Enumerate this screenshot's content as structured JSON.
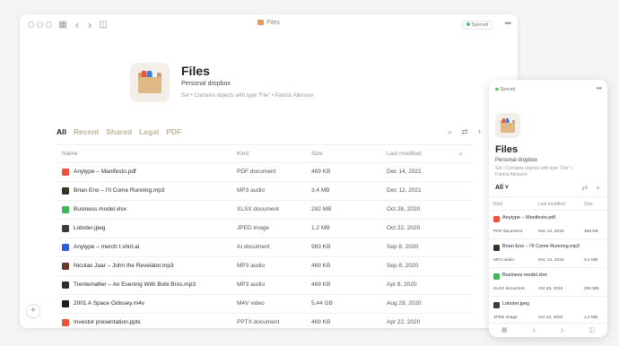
{
  "window": {
    "title": "Files",
    "sync_status": "Synced",
    "more": "•••",
    "grid_icon": "▦",
    "back_icon": "‹",
    "forward_icon": "›",
    "sidebar_icon": "◫"
  },
  "header": {
    "title": "Files",
    "subtitle": "Personal dropbox",
    "meta": "Set  •  Contains objects with type “File”  •  Patrick Atkinson"
  },
  "tabs": [
    "All",
    "Recent",
    "Shared",
    "Legal",
    "PDF"
  ],
  "toolbar": {
    "search": "⌕",
    "filter": "⇄",
    "add": "+"
  },
  "table": {
    "columns": [
      "Name",
      "Kind",
      "Size",
      "Last modified"
    ],
    "add": "+",
    "rows": [
      {
        "name": "Anytype – Manifesto.pdf",
        "kind": "PDF document",
        "size": "469 KB",
        "modified": "Dec 14, 2021",
        "color": "#e8553b"
      },
      {
        "name": "Brian Eno – I’ll Come Running.mp3",
        "kind": "MP3 audio",
        "size": "3,4 MB",
        "modified": "Dec 12, 2021",
        "color": "#3a3226"
      },
      {
        "name": "Business model.xlsx",
        "kind": "XLSX document",
        "size": "292 MB",
        "modified": "Oct 28, 2020",
        "color": "#43b55c"
      },
      {
        "name": "Lobster.jpeg",
        "kind": "JPED image",
        "size": "1,2 MB",
        "modified": "Oct 22, 2020",
        "color": "#3c3c3c"
      },
      {
        "name": "Anytype – merch t shirt.ai",
        "kind": "AI document",
        "size": "983 KB",
        "modified": "Sep 8, 2020",
        "color": "#2f5fd8"
      },
      {
        "name": "Nicolas Jaar – John the Revelator.mp3",
        "kind": "MP3 audio",
        "size": "469 KB",
        "modified": "Sep 8, 2020",
        "color": "#6a3a2c"
      },
      {
        "name": "Trentemøller – An Evening With Bobi Bros.mp3",
        "kind": "MP3 audio",
        "size": "469 KB",
        "modified": "Apr 8, 2020",
        "color": "#2e2e2e"
      },
      {
        "name": "2001 A Space Odissey.m4v",
        "kind": "M4V video",
        "size": "5,44 GB",
        "modified": "Aug 29, 2020",
        "color": "#1e1e1e"
      },
      {
        "name": "Investor presentation.pptx",
        "kind": "PPTX document",
        "size": "469 KB",
        "modified": "Apr 22, 2020",
        "color": "#e8553b"
      }
    ]
  },
  "fab": "+",
  "mobile": {
    "sync_status": "Synced",
    "more": "•••",
    "title": "Files",
    "subtitle": "Personal dropbox",
    "meta": "Set • Contains objects with type “File” • Patrick Atkinson",
    "view": "All ˅",
    "filter": "⇄",
    "add": "+",
    "columns": [
      "Kind",
      "Last modified",
      "Size"
    ],
    "items": [
      {
        "name": "Anytype – Manifesto.pdf",
        "kind": "PDF document",
        "modified": "Dec 14, 2019",
        "size": "469 KB",
        "color": "#e8553b"
      },
      {
        "name": "Brian Eno – I’ll Come Running.mp3",
        "kind": "MP3 audio",
        "modified": "Dec 14, 2019",
        "size": "3,4 MB",
        "color": "#3a3226"
      },
      {
        "name": "Business model.xlsx",
        "kind": "XLSX document",
        "modified": "Oct 28, 2019",
        "size": "292 MB",
        "color": "#43b55c"
      },
      {
        "name": "Lobster.jpeg",
        "kind": "JPED image",
        "modified": "Oct 22, 2020",
        "size": "1,2 MB",
        "color": "#3c3c3c"
      }
    ],
    "nav": [
      "▦",
      "‹",
      "›",
      "◫"
    ]
  }
}
